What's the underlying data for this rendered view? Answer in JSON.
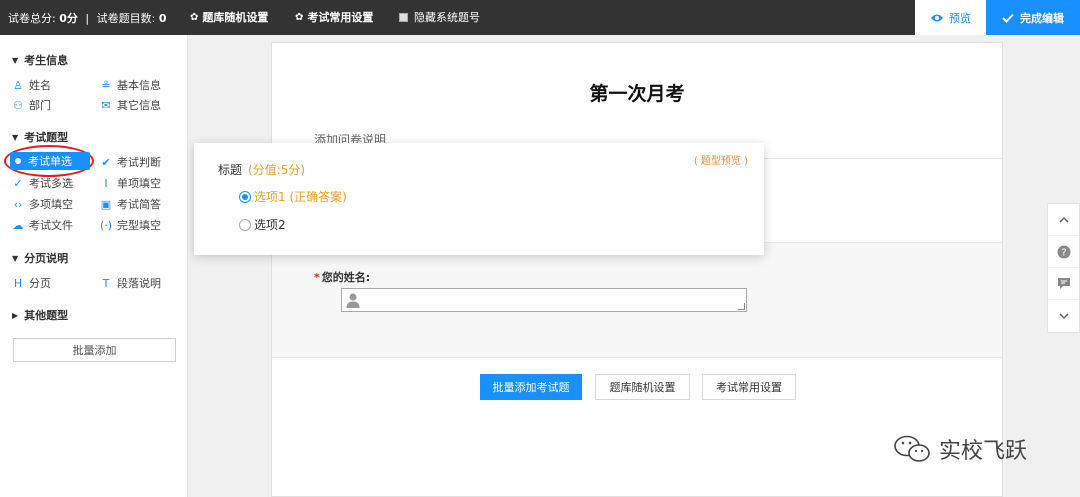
{
  "topbar": {
    "total_label": "试卷总分:",
    "total_value": "0分",
    "sep": "|",
    "count_label": "试卷题目数:",
    "count_value": "0",
    "random_label": "题库随机设置",
    "common_label": "考试常用设置",
    "hide_label": "隐藏系统题号",
    "preview_label": "预览",
    "finish_label": "完成编辑"
  },
  "sidebar": {
    "sec_candidate": "考生信息",
    "name": "姓名",
    "basic_info": "基本信息",
    "department": "部门",
    "other_info": "其它信息",
    "sec_exam": "考试题型",
    "single": "考试单选",
    "judge": "考试判断",
    "multi": "考试多选",
    "single_blank": "单项填空",
    "multi_blank": "多项填空",
    "short_answer": "考试简答",
    "file": "考试文件",
    "cloze": "完型填空",
    "sec_page": "分页说明",
    "page": "分页",
    "paragraph": "段落说明",
    "sec_other": "其他题型",
    "batch_add": "批量添加"
  },
  "paper": {
    "title": "第一次月考",
    "desc": "添加问卷说明",
    "name_label": "您的姓名:",
    "required_mark": "*",
    "buttons": {
      "batch": "批量添加考试题",
      "random": "题库随机设置",
      "common": "考试常用设置"
    }
  },
  "popup": {
    "tag": "( 题型预览 )",
    "title": "标题",
    "score": "(分值:5分)",
    "option1": "选项1 (正确答案)",
    "option2": "选项2"
  },
  "watermark": "实校飞跃",
  "colors": {
    "accent": "#1890ff",
    "topbar": "#333333",
    "highlight": "#e02020",
    "score": "#f0a020"
  }
}
